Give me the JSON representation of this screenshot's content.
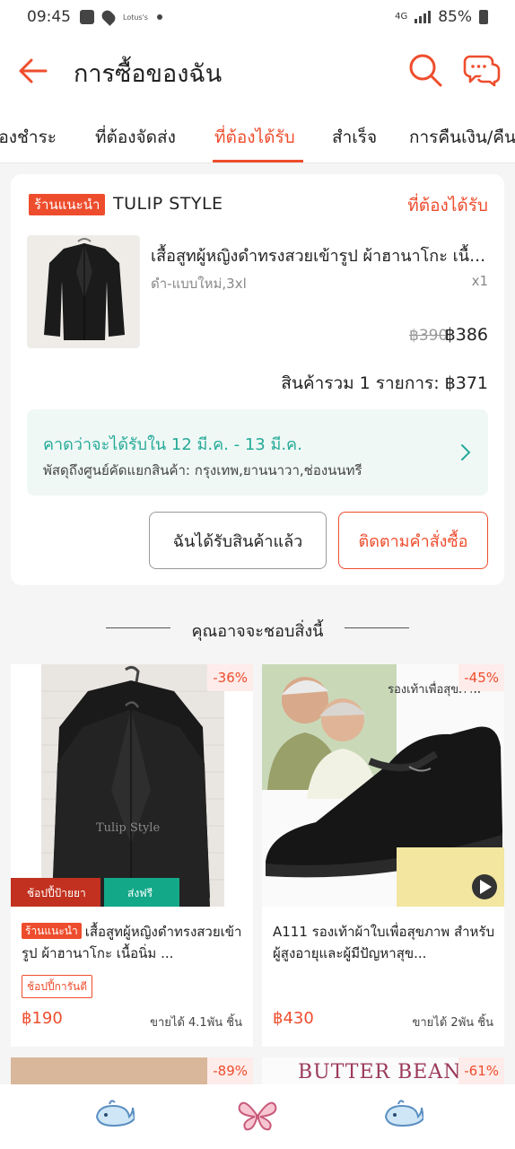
{
  "status_bar": {
    "time": "09:45",
    "carrier_tag": "Lotus's",
    "network": "4G",
    "battery": "85%"
  },
  "header": {
    "title": "การซื้อของฉัน"
  },
  "tabs": [
    {
      "label": "ต้องชำระ"
    },
    {
      "label": "ที่ต้องจัดส่ง"
    },
    {
      "label": "ที่ต้องได้รับ",
      "active": true
    },
    {
      "label": "สำเร็จ"
    },
    {
      "label": "การคืนเงิน/คืนสินค้า"
    }
  ],
  "order": {
    "shop_badge": "ร้านแนะนำ",
    "shop_name": "TULIP STYLE",
    "status": "ที่ต้องได้รับ",
    "product_name": "เสื้อสูทผู้หญิงดำทรงสวยเข้ารูป ผ้าฮานาโกะ เนื้อนิ่ม",
    "variant": "ดำ-แบบใหม่,3xl",
    "quantity": "x1",
    "original_price": "฿390",
    "price": "฿386",
    "total": "สินค้ารวม 1 รายการ: ฿371",
    "delivery_estimate": "คาดว่าจะได้รับใน 12 มี.ค. - 13 มี.ค.",
    "delivery_location": "พัสดุถึงศูนย์คัดแยกสินค้า: กรุงเทพ,ยานนาวา,ช่องนนทรี",
    "received_button": "ฉันได้รับสินค้าแล้ว",
    "track_button": "ติดตามคำสั่งซื้อ"
  },
  "recommendations": {
    "title": "คุณอาจจะชอบสิ่งนี้",
    "items": [
      {
        "discount": "-36%",
        "badge": "ร้านแนะนำ",
        "title": "เสื้อสูทผู้หญิงดำทรงสวยเข้ารูป ผ้าฮานาโกะ เนื้อนิ่ม ...",
        "image_text": "Tulip Style",
        "overlay_left": "ช้อปปี้ป้ายยา",
        "overlay_right": "ส่งฟรี",
        "tag": "ช้อปปี้การันตี",
        "price": "฿190",
        "sold": "ขายได้ 4.1พัน ชิ้น"
      },
      {
        "discount": "-45%",
        "badge": "",
        "title": "A111 รองเท้าผ้าใบเพื่อสุขภาพ สำหรับผู้สูงอายุและผู้มีปัญหาสุข...",
        "image_text": "รองเท้าเพื่อสุขภาพ",
        "price": "฿430",
        "sold": "ขายได้ 2พัน ชิ้น"
      },
      {
        "discount": "-89%"
      },
      {
        "discount": "-61%",
        "image_text": "BUTTER BEAN"
      }
    ]
  },
  "colors": {
    "brand": "#ee4d2d",
    "delivery_text": "#26aa99",
    "delivery_bg": "#eff8f5"
  },
  "bottom_nav": [
    "whale-icon",
    "butterfly-icon",
    "whale-icon"
  ]
}
